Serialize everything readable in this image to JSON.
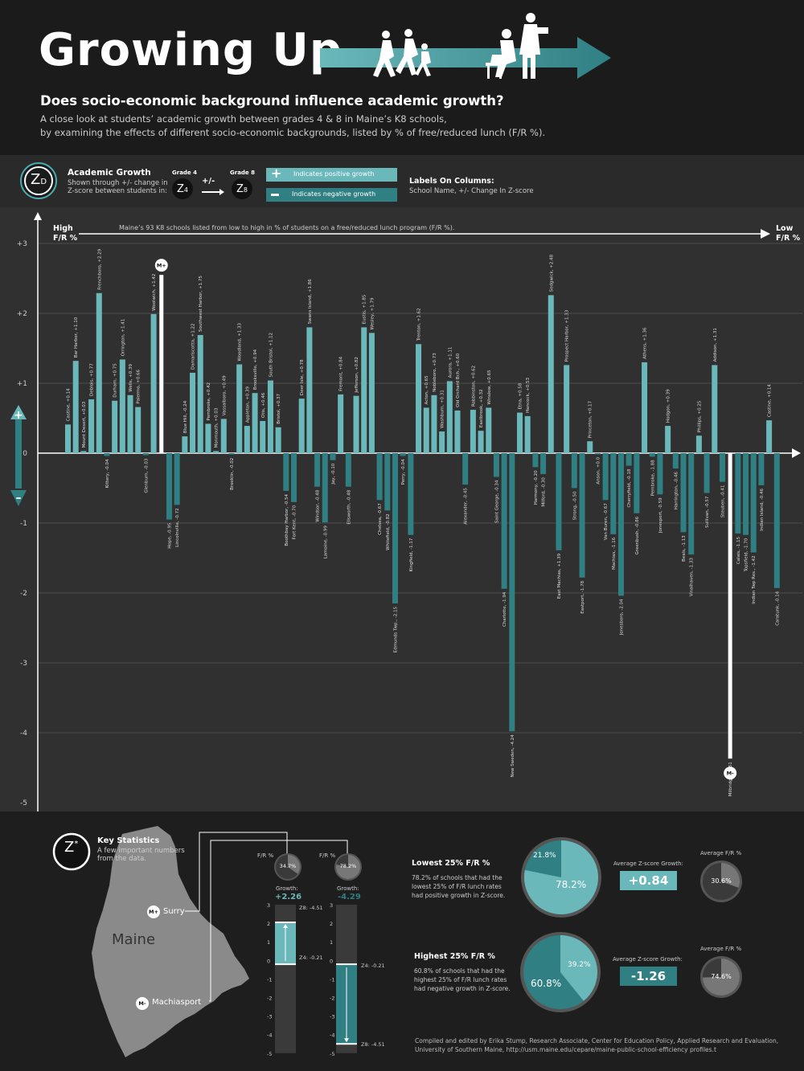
{
  "header": {
    "title": "Growing Up",
    "question": "Does socio-economic background influence academic growth?",
    "description_line1": "A close look at students’ academic growth between grades 4 & 8 in Maine’s K8 schools,",
    "description_line2": "by examining the effects of different socio-economic backgrounds, listed by % of free/reduced lunch (F/R %)."
  },
  "legend": {
    "z_symbol": "Z",
    "z_sub": "D",
    "title": "Academic Growth",
    "desc_line1": "Shown through +/- change in",
    "desc_line2": "Z-score between students in:",
    "grade4": "Grade 4",
    "grade8": "Grade 8",
    "z4": "Z",
    "z4_sub": "4",
    "z8": "Z",
    "z8_sub": "8",
    "plusminus": "+/-",
    "positive_label": "Indicates positive growth",
    "negative_label": "Indicates negative growth",
    "columns_title": "Labels On Columns:",
    "columns_desc": "School Name, +/- Change In Z-score",
    "colors": {
      "positive": "#6bb8bb",
      "negative": "#2f7f83",
      "accent": "#3e9ea2"
    }
  },
  "axis": {
    "left_top": "High",
    "left_bottom": "F/R %",
    "right_top": "Low",
    "right_bottom": "F/R %",
    "note": "Maine’s 93 K8 schools listed from low to high in % of students on a free/reduced lunch program (F/R %).",
    "plus": "+",
    "minus": "–"
  },
  "chart_data": {
    "type": "bar",
    "ylim": [
      -5,
      3
    ],
    "yticks": [
      "+3",
      "+2",
      "+1",
      "0",
      "-1",
      "-2",
      "-3",
      "-4",
      "-5"
    ],
    "tick_values": [
      3,
      2,
      1,
      0,
      -1,
      -2,
      -3,
      -4,
      -5
    ],
    "max_marker": "M+",
    "min_marker": "M-",
    "series": [
      {
        "categories": [
          "Castine",
          "Bar Harbor",
          "Mount Desert",
          "Deblois",
          "Frenchboro",
          "Kittery",
          "Durham",
          "Orrington",
          "Wells",
          "Palermo",
          "Glenburn",
          "Woolwich",
          "Surry",
          "Hope",
          "Lincolnville",
          "Blue Hill",
          "Damariscotta",
          "Southwest Harbor",
          "Pembroke",
          "Monmouth",
          "Vassalboro",
          "Brooklin",
          "Woodland",
          "Appleton",
          "Brooksville",
          "Otis",
          "South Bristol",
          "Bristol",
          "Boothbay Harbor",
          "Fort Kent",
          "Deer Isle",
          "Swans Island",
          "Windsor",
          "Lamoine",
          "Jay",
          "Fremont",
          "Ellsworth",
          "Jefferson",
          "Eustis",
          "Wesley",
          "Chelsea",
          "Whitefield",
          "Edmunds Twp.",
          "Perry",
          "Kingfield",
          "Trenton",
          "Acton",
          "Nobleboro",
          "Washburn",
          "Aurora",
          "Old Orchard Bch.",
          "Alexander",
          "Robbinston",
          "Eastbrook",
          "Winslow",
          "Saint George",
          "Charlotte",
          "New Sweden",
          "Etna",
          "Hancock",
          "Harmony",
          "Milford",
          "Sedgwick",
          "East Machias",
          "Prospect Harbor",
          "Strong",
          "Eastport",
          "Princeton",
          "Anson",
          "Van Buren",
          "Machias",
          "Jonesboro",
          "Cherryfield",
          "Greenbush",
          "Athens",
          "Pembroke",
          "Jonesport",
          "Hodgon",
          "Harrington",
          "Beals",
          "Vinalhaven",
          "Phillips",
          "Sullivan",
          "Addison",
          "Steuben",
          "Machiasport",
          "Calais",
          "Topsfield",
          "Indian Twp Res.",
          "Indian Island",
          "Castine",
          "Caratunk"
        ],
        "values": [
          0.41,
          1.32,
          0.03,
          0.77,
          2.29,
          -0.04,
          0.75,
          1.34,
          0.83,
          0.66,
          -0.03,
          1.99,
          2.55,
          -0.95,
          -0.74,
          0.24,
          1.15,
          1.69,
          0.42,
          0.03,
          0.49,
          -0.02,
          1.27,
          0.39,
          0.86,
          0.46,
          1.04,
          0.37,
          -0.54,
          -0.7,
          0.78,
          1.8,
          -0.48,
          -0.99,
          -0.1,
          0.84,
          -0.48,
          0.82,
          1.8,
          1.72,
          -0.67,
          -0.82,
          -2.15,
          -0.04,
          -1.17,
          1.56,
          0.65,
          0.83,
          0.31,
          1.03,
          0.61,
          -0.45,
          0.62,
          0.32,
          0.65,
          -0.34,
          -1.94,
          -3.98,
          0.58,
          0.53,
          -0.2,
          -0.3,
          2.26,
          -1.39,
          1.26,
          -0.5,
          -1.78,
          0.17,
          -0.01,
          -0.67,
          -1.16,
          -2.04,
          -0.18,
          -0.86,
          1.3,
          -0.05,
          -0.59,
          0.39,
          -0.22,
          -1.13,
          -1.45,
          0.25,
          -0.57,
          1.26,
          -0.41,
          -4.37,
          -1.15,
          -1.17,
          -1.42,
          -0.46,
          0.47,
          -1.93
        ],
        "labels": [
          "Castine, +0.14",
          "Bar Harbor, +1.10",
          "Mount Desert, +0.03",
          "Deblois, +0.77",
          "Frenchboro, +2.29",
          "Kittery, -0.04",
          "Durham, +0.75",
          "Orrington, +1.41",
          "Wells, +0.39",
          "Palermo, +0.66",
          "Glenburn, -0.03",
          "Woolwich, +1.42",
          "",
          "Hope, -0.95",
          "Lincolnville, -0.72",
          "Blue Hill, -0.24",
          "Damariscotta, +1.22",
          "Southwest Harbor, +1.75",
          "Pembroke, +0.42",
          "Monmouth, +0.03",
          "Vassalboro, +0.49",
          "Brooklin, -0.02",
          "Woodland, +1.33",
          "Appleton, +0.39",
          "Brooksville, +0.94",
          "Otis, +0.46",
          "South Bristol, +1.12",
          "Bristol, +0.37",
          "Boothbay Harbor, -0.54",
          "Fort Kent, -0.70",
          "Deer Isle, +0.78",
          "Swans Island, +1.86",
          "Windsor, -0.48",
          "Lamoine, -0.99",
          "Jay, -0.10",
          "Fremont, +0.84",
          "Ellsworth, -0.48",
          "Jefferson, +0.82",
          "Eustis, +1.85",
          "Wesley, +1.79",
          "Chelsea, -0.67",
          "Whitefield, -0.82",
          "Edmunds Twp., -2.15",
          "Perry, -0.04",
          "Kingfield, -1.17",
          "Trenton, +1.62",
          "Acton, +0.65",
          "Nobleboro, +0.73",
          "Washburn, +0.31",
          "Aurora, +1.11",
          "Old Orchard Bch., +0.60",
          "Alexander, -0.45",
          "Robbinston, +0.62",
          "Eastbrook, +0.32",
          "Winslow, +0.65",
          "Saint George, -0.34",
          "Charlotte, -1.94",
          "New Sweden, -4.24",
          "Etna, +0.58",
          "Hancock, +0.53",
          "Harmony, -0.20",
          "Milford, -0.30",
          "Sedgwick, +2.48",
          "East Machias, +1.39",
          "Prospect Harbor, +1.33",
          "Strong, -0.50",
          "Eastport, -1.78",
          "Princeton, +0.17",
          "Anson, +0.0",
          "Van Buren, -0.67",
          "Machias, -1.16",
          "Jonesboro, -2.04",
          "Cherryfield, -0.18",
          "Greenbush, -0.86",
          "Athens, +1.36",
          "Pembroke, -1.88",
          "Jonesport, -0.59",
          "Hodgon, +0.39",
          "Harrington, -0.46",
          "Beals, -1.13",
          "Vinalhaven, -1.33",
          "Phillips, +0.25",
          "Sullivan, -0.57",
          "Addison, +1.31",
          "Steuben, -0.41",
          "Milbridge, -3.61",
          "Calais, -1.15",
          "Topsfield, -1.70",
          "Indian Twp Res., -1.42",
          "Indian Island, -0.46",
          "Castine, +0.14",
          "Caratunk, -0.14"
        ]
      }
    ]
  },
  "stats": {
    "z_symbol": "Z",
    "z_star": "*",
    "title": "Key Statistics",
    "desc_line1": "A few important numbers",
    "desc_line2": "from the data.",
    "map_label": "Maine",
    "surry_label": "Surry",
    "machiasport_label": "Machiasport",
    "mplus": "M+",
    "mminus": "M-",
    "fr_label": "F/R %",
    "growth_label": "Growth:",
    "surry_fr": "34.7%",
    "surry_fr_value": 34.7,
    "surry_growth": "+2.26",
    "surry_z8": "Z8: -4.51",
    "surry_z4": "Z4: -0.21",
    "mach_fr": "78.2%",
    "mach_fr_value": 78.2,
    "mach_growth": "-4.29",
    "mach_z4": "Z4: -0.21",
    "mach_z8": "Z8: -4.51",
    "scale": [
      "3",
      "2",
      "1",
      "0",
      "-1",
      "-2",
      "-3",
      "-4",
      "-5"
    ],
    "lowest_title": "Lowest 25% F/R %",
    "lowest_desc1": "78.2% of schools that had the",
    "lowest_desc2": "lowest 25% of F/R lunch rates",
    "lowest_desc3": "had positive growth in Z-score.",
    "lowest_pie_big": "78.2%",
    "lowest_pie_small": "21.8%",
    "lowest_pie_value": 78.2,
    "avg_z_label": "Average Z-score Growth:",
    "lowest_avg_z": "+0.84",
    "avg_fr_label": "Average F/R %",
    "lowest_avg_fr": "30.6%",
    "lowest_avg_fr_value": 30.6,
    "highest_title": "Highest 25% F/R %",
    "highest_desc1": "60.8% of schools that had the",
    "highest_desc2": "highest 25% of F/R lunch rates",
    "highest_desc3": "had negative growth in Z-score.",
    "highest_pie_big": "60.8%",
    "highest_pie_small": "39.2%",
    "highest_pie_value": 60.8,
    "highest_avg_z": "-1.26",
    "highest_avg_fr": "74.6%",
    "highest_avg_fr_value": 74.6,
    "credit_line1": "Compiled and edited by Erika Stump, Research Associate, Center for Education Policy, Applied Research and Evaluation,",
    "credit_line2": "University of Southern Maine, http://usm.maine.edu/cepare/maine-public-school-efficiency profiles.t"
  }
}
